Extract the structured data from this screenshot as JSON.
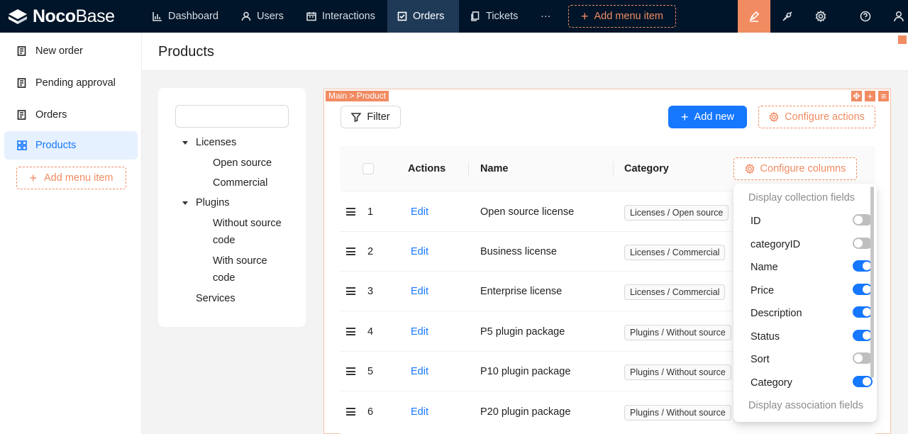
{
  "brand": {
    "bold": "Noco",
    "light": "Base"
  },
  "nav": [
    {
      "label": "Dashboard",
      "icon": "bar-chart-icon"
    },
    {
      "label": "Users",
      "icon": "user-icon"
    },
    {
      "label": "Interactions",
      "icon": "calendar-icon"
    },
    {
      "label": "Orders",
      "icon": "form-icon",
      "active": true
    },
    {
      "label": "Tickets",
      "icon": "copy-icon"
    }
  ],
  "nav_more": "···",
  "nav_add_label": "Add menu item",
  "sidebar": {
    "items": [
      {
        "label": "New order",
        "icon": "form-icon"
      },
      {
        "label": "Pending approval",
        "icon": "form-icon"
      },
      {
        "label": "Orders",
        "icon": "form-icon"
      },
      {
        "label": "Products",
        "icon": "appstore-icon",
        "active": true
      }
    ],
    "add_label": "Add menu item"
  },
  "page": {
    "title": "Products"
  },
  "tree": {
    "search_placeholder": "",
    "nodes": [
      {
        "label": "Licenses",
        "level": 0,
        "expanded": true
      },
      {
        "label": "Open source",
        "level": 1
      },
      {
        "label": "Commercial",
        "level": 1
      },
      {
        "label": "Plugins",
        "level": 0,
        "expanded": true
      },
      {
        "label": "Without source code",
        "level": 1
      },
      {
        "label": "With source code",
        "level": 1
      },
      {
        "label": "Services",
        "level": 0
      }
    ]
  },
  "block": {
    "tag": "Main > Product",
    "filter_label": "Filter",
    "add_new_label": "Add new",
    "configure_actions_label": "Configure actions",
    "configure_columns_label": "Configure columns"
  },
  "table": {
    "columns": [
      "Actions",
      "Name",
      "Category"
    ],
    "rows": [
      {
        "index": "1",
        "action": "Edit",
        "name": "Open source license",
        "category": "Licenses / Open source"
      },
      {
        "index": "2",
        "action": "Edit",
        "name": "Business license",
        "category": "Licenses / Commercial"
      },
      {
        "index": "3",
        "action": "Edit",
        "name": "Enterprise license",
        "category": "Licenses / Commercial"
      },
      {
        "index": "4",
        "action": "Edit",
        "name": "P5 plugin package",
        "category": "Plugins / Without source"
      },
      {
        "index": "5",
        "action": "Edit",
        "name": "P10 plugin package",
        "category": "Plugins / Without source"
      },
      {
        "index": "6",
        "action": "Edit",
        "name": "P20 plugin package",
        "category": "Plugins / Without source"
      }
    ]
  },
  "columns_menu": {
    "group_collection": "Display collection fields",
    "fields": [
      {
        "label": "ID",
        "enabled": false
      },
      {
        "label": "categoryID",
        "enabled": false
      },
      {
        "label": "Name",
        "enabled": true
      },
      {
        "label": "Price",
        "enabled": true
      },
      {
        "label": "Description",
        "enabled": true
      },
      {
        "label": "Status",
        "enabled": true
      },
      {
        "label": "Sort",
        "enabled": false
      },
      {
        "label": "Category",
        "enabled": true
      }
    ],
    "group_association": "Display association fields"
  },
  "colors": {
    "accent": "#f18b62",
    "primary": "#1677ff",
    "header_bg": "#001529"
  }
}
